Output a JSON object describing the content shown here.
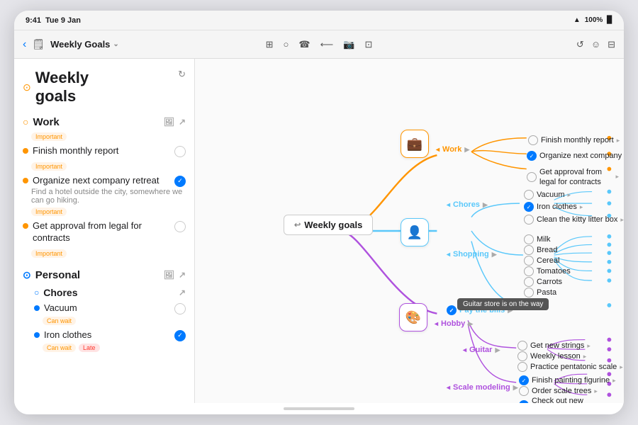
{
  "status_bar": {
    "time": "9:41",
    "date": "Tue 9 Jan",
    "wifi": "WiFi",
    "battery": "100%",
    "battery_icon": "🔋"
  },
  "toolbar": {
    "back_label": "‹",
    "doc_icon": "📄",
    "title": "Weekly Goals",
    "chevron": "⌄",
    "icons": [
      "⊞",
      "○",
      "☎",
      "←",
      "📷",
      "⊡"
    ],
    "right_icons": [
      "↺",
      "😊",
      "⊟"
    ]
  },
  "sidebar": {
    "title": "Weekly\ngoals",
    "refresh_icon": "↻",
    "sections": [
      {
        "name": "Work",
        "icon": "○",
        "color": "orange",
        "tasks": [
          {
            "text": "Finish monthly report",
            "tag": "Important",
            "checked": false
          },
          {
            "text": "Organize next company retreat",
            "note": "Find a hotel outside the city, somewhere we can go hiking.",
            "tag": "Important",
            "checked": true
          },
          {
            "text": "Get approval from legal for contracts",
            "tag": "Important",
            "checked": false
          }
        ]
      },
      {
        "name": "Personal",
        "icon": "○",
        "color": "blue",
        "subsections": [
          {
            "name": "Chores",
            "icon": "○",
            "tasks": [
              {
                "text": "Vacuum",
                "tag": "Can wait",
                "checked": false,
                "dot_color": "blue"
              },
              {
                "text": "Iron clothes",
                "tag": "Can wait",
                "tag2": "Late",
                "checked": true,
                "dot_color": "blue"
              }
            ]
          }
        ]
      }
    ]
  },
  "mindmap": {
    "center_label": "Weekly goals",
    "categories": [
      {
        "id": "work",
        "label": "Work",
        "icon": "💼",
        "color": "#ff9500"
      },
      {
        "id": "personal",
        "label": "Personal",
        "icon": "👤",
        "color": "#5ac8fa"
      },
      {
        "id": "hobby",
        "label": "Hobby",
        "icon": "🎨",
        "color": "#af52de"
      }
    ],
    "work_nodes": [
      {
        "text": "Finish monthly report",
        "checked": false
      },
      {
        "text": "Organize next company retreat",
        "checked": true
      },
      {
        "text": "Get approval from legal for contracts",
        "checked": false
      }
    ],
    "chores_nodes": [
      {
        "text": "Vacuum",
        "checked": false
      },
      {
        "text": "Iron clothes",
        "checked": true
      },
      {
        "text": "Clean the kitty litter box",
        "checked": false
      }
    ],
    "shopping_nodes": [
      {
        "text": "Milk"
      },
      {
        "text": "Bread"
      },
      {
        "text": "Cereal"
      },
      {
        "text": "Tomatoes"
      },
      {
        "text": "Carrots"
      },
      {
        "text": "Pasta"
      }
    ],
    "guitar_nodes": [
      {
        "text": "Get new strings",
        "checked": false
      },
      {
        "text": "Weekly lesson",
        "checked": false
      },
      {
        "text": "Practice pentatonic scale",
        "checked": false
      }
    ],
    "scale_nodes": [
      {
        "text": "Finish painting figurine",
        "checked": true
      },
      {
        "text": "Order scale trees",
        "checked": false
      },
      {
        "text": "Check out new weathering techniques",
        "checked": true
      }
    ],
    "tooltip": "Guitar store is on the way"
  }
}
